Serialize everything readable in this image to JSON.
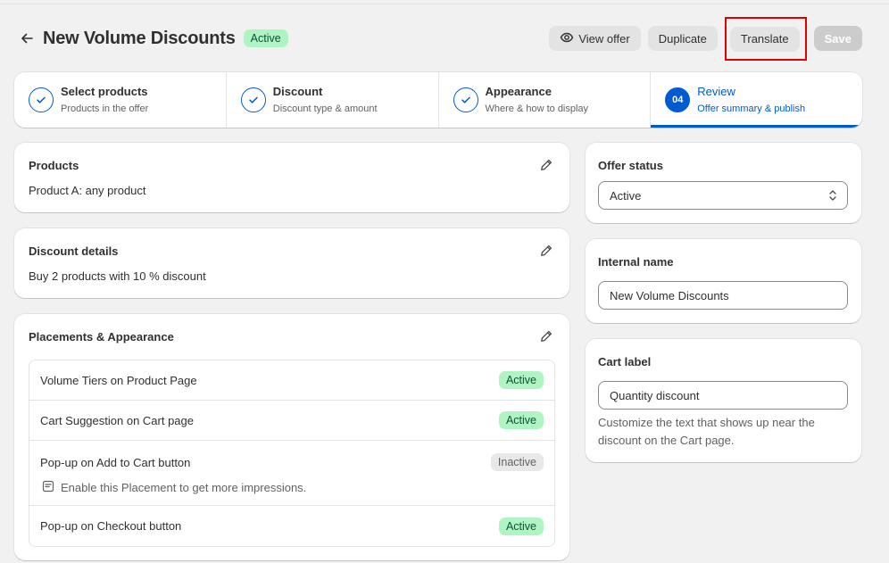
{
  "header": {
    "title": "New Volume Discounts",
    "status_badge": "Active",
    "view_offer_label": "View offer",
    "duplicate_label": "Duplicate",
    "translate_label": "Translate",
    "save_label": "Save"
  },
  "stepper": {
    "steps": [
      {
        "title": "Select products",
        "subtitle": "Products in the offer",
        "state": "done"
      },
      {
        "title": "Discount",
        "subtitle": "Discount type & amount",
        "state": "done"
      },
      {
        "title": "Appearance",
        "subtitle": "Where & how to display",
        "state": "done"
      },
      {
        "number": "04",
        "title": "Review",
        "subtitle": "Offer summary & publish",
        "state": "current"
      }
    ]
  },
  "products_card": {
    "title": "Products",
    "text": "Product A: any product"
  },
  "discount_card": {
    "title": "Discount details",
    "text": "Buy 2 products with 10 % discount"
  },
  "placements_card": {
    "title": "Placements & Appearance",
    "items": [
      {
        "name": "Volume Tiers on Product Page",
        "status": "Active"
      },
      {
        "name": "Cart Suggestion on Cart page",
        "status": "Active"
      },
      {
        "name": "Pop-up on Add to Cart button",
        "status": "Inactive",
        "hint": "Enable this Placement to get more impressions."
      },
      {
        "name": "Pop-up on Checkout button",
        "status": "Active"
      }
    ]
  },
  "offer_status": {
    "title": "Offer status",
    "value": "Active"
  },
  "internal_name": {
    "title": "Internal name",
    "value": "New Volume Discounts"
  },
  "cart_label": {
    "title": "Cart label",
    "value": "Quantity discount",
    "help": "Customize the text that shows up near the discount on the Cart page."
  },
  "colors": {
    "accent": "#005bd3",
    "active_badge_bg": "#aff5c4",
    "active_badge_text": "#0c5132",
    "highlight_border": "#e00000"
  }
}
